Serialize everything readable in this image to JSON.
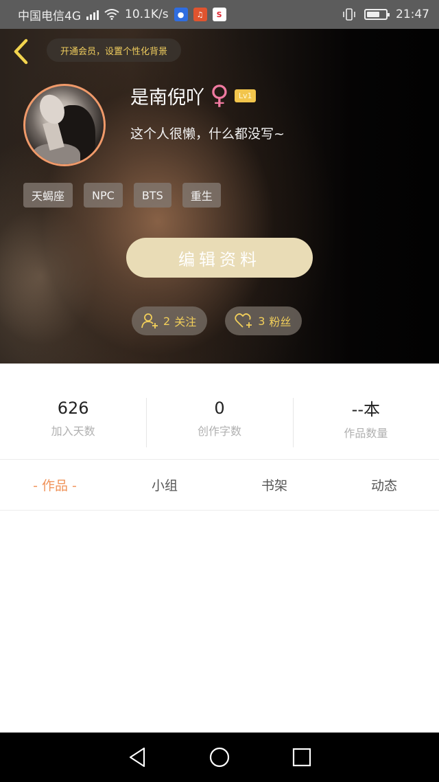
{
  "status_bar": {
    "carrier": "中国电信4G",
    "network_type": "4G",
    "speed": "10.1K/s",
    "time": "21:47",
    "app_icons": [
      "baidu-app-icon",
      "music-app-icon",
      "sina-weibo-icon"
    ]
  },
  "header": {
    "vip_prompt": "开通会员，设置个性化背景"
  },
  "profile": {
    "username": "是南倪吖",
    "gender_symbol": "♀",
    "level": "Lv1",
    "bio": "这个人很懒，什么都没写~",
    "tags": [
      "天蝎座",
      "NPC",
      "BTS",
      "重生"
    ],
    "edit_label": "编辑资料",
    "following": {
      "count": "2",
      "label": "关注"
    },
    "followers": {
      "count": "3",
      "label": "粉丝"
    }
  },
  "stats": [
    {
      "value": "626",
      "label": "加入天数"
    },
    {
      "value": "0",
      "label": "创作字数"
    },
    {
      "value": "--本",
      "label": "作品数量"
    }
  ],
  "tabs": [
    {
      "label": "- 作品 -",
      "active": true
    },
    {
      "label": "小组",
      "active": false
    },
    {
      "label": "书架",
      "active": false
    },
    {
      "label": "动态",
      "active": false
    }
  ],
  "colors": {
    "accent_gold": "#f0cd5e",
    "active_tab": "#f0935a",
    "edit_button": "#e9dcb6",
    "avatar_ring": "#f09a6a",
    "gender_pink": "#f07aa0"
  }
}
